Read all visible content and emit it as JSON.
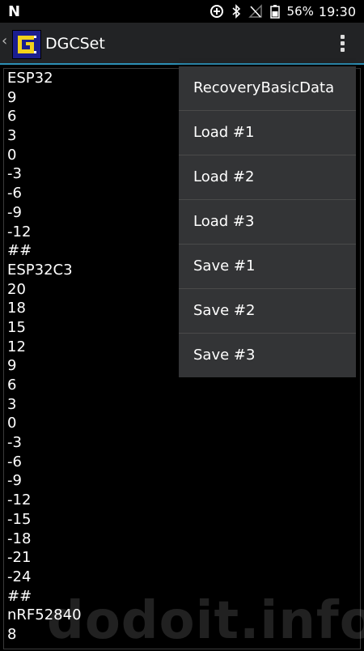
{
  "status_bar": {
    "notification_letter": "N",
    "battery_percent": "56%",
    "time": "19:30",
    "icons": [
      "data-saver-icon",
      "bluetooth-icon",
      "no-signal-icon",
      "battery-icon"
    ]
  },
  "action_bar": {
    "title": "DGCSet",
    "back_glyph": "‹"
  },
  "content_lines": [
    "ESP32",
    "9",
    "6",
    "3",
    "0",
    "-3",
    "-6",
    "-9",
    "-12",
    "##",
    "ESP32C3",
    "20",
    "18",
    "15",
    "12",
    "9",
    "6",
    "3",
    "0",
    "-3",
    "-6",
    "-9",
    "-12",
    "-15",
    "-18",
    "-21",
    "-24",
    "##",
    "nRF52840",
    "8"
  ],
  "menu": {
    "items": [
      "RecoveryBasicData",
      "Load #1",
      "Load #2",
      "Load #3",
      "Save #1",
      "Save #2",
      "Save #3"
    ]
  },
  "watermark": "dodoit.info",
  "colors": {
    "accent_line": "#2d8fb5",
    "action_bar": "#222325",
    "menu_bg": "#333436"
  }
}
